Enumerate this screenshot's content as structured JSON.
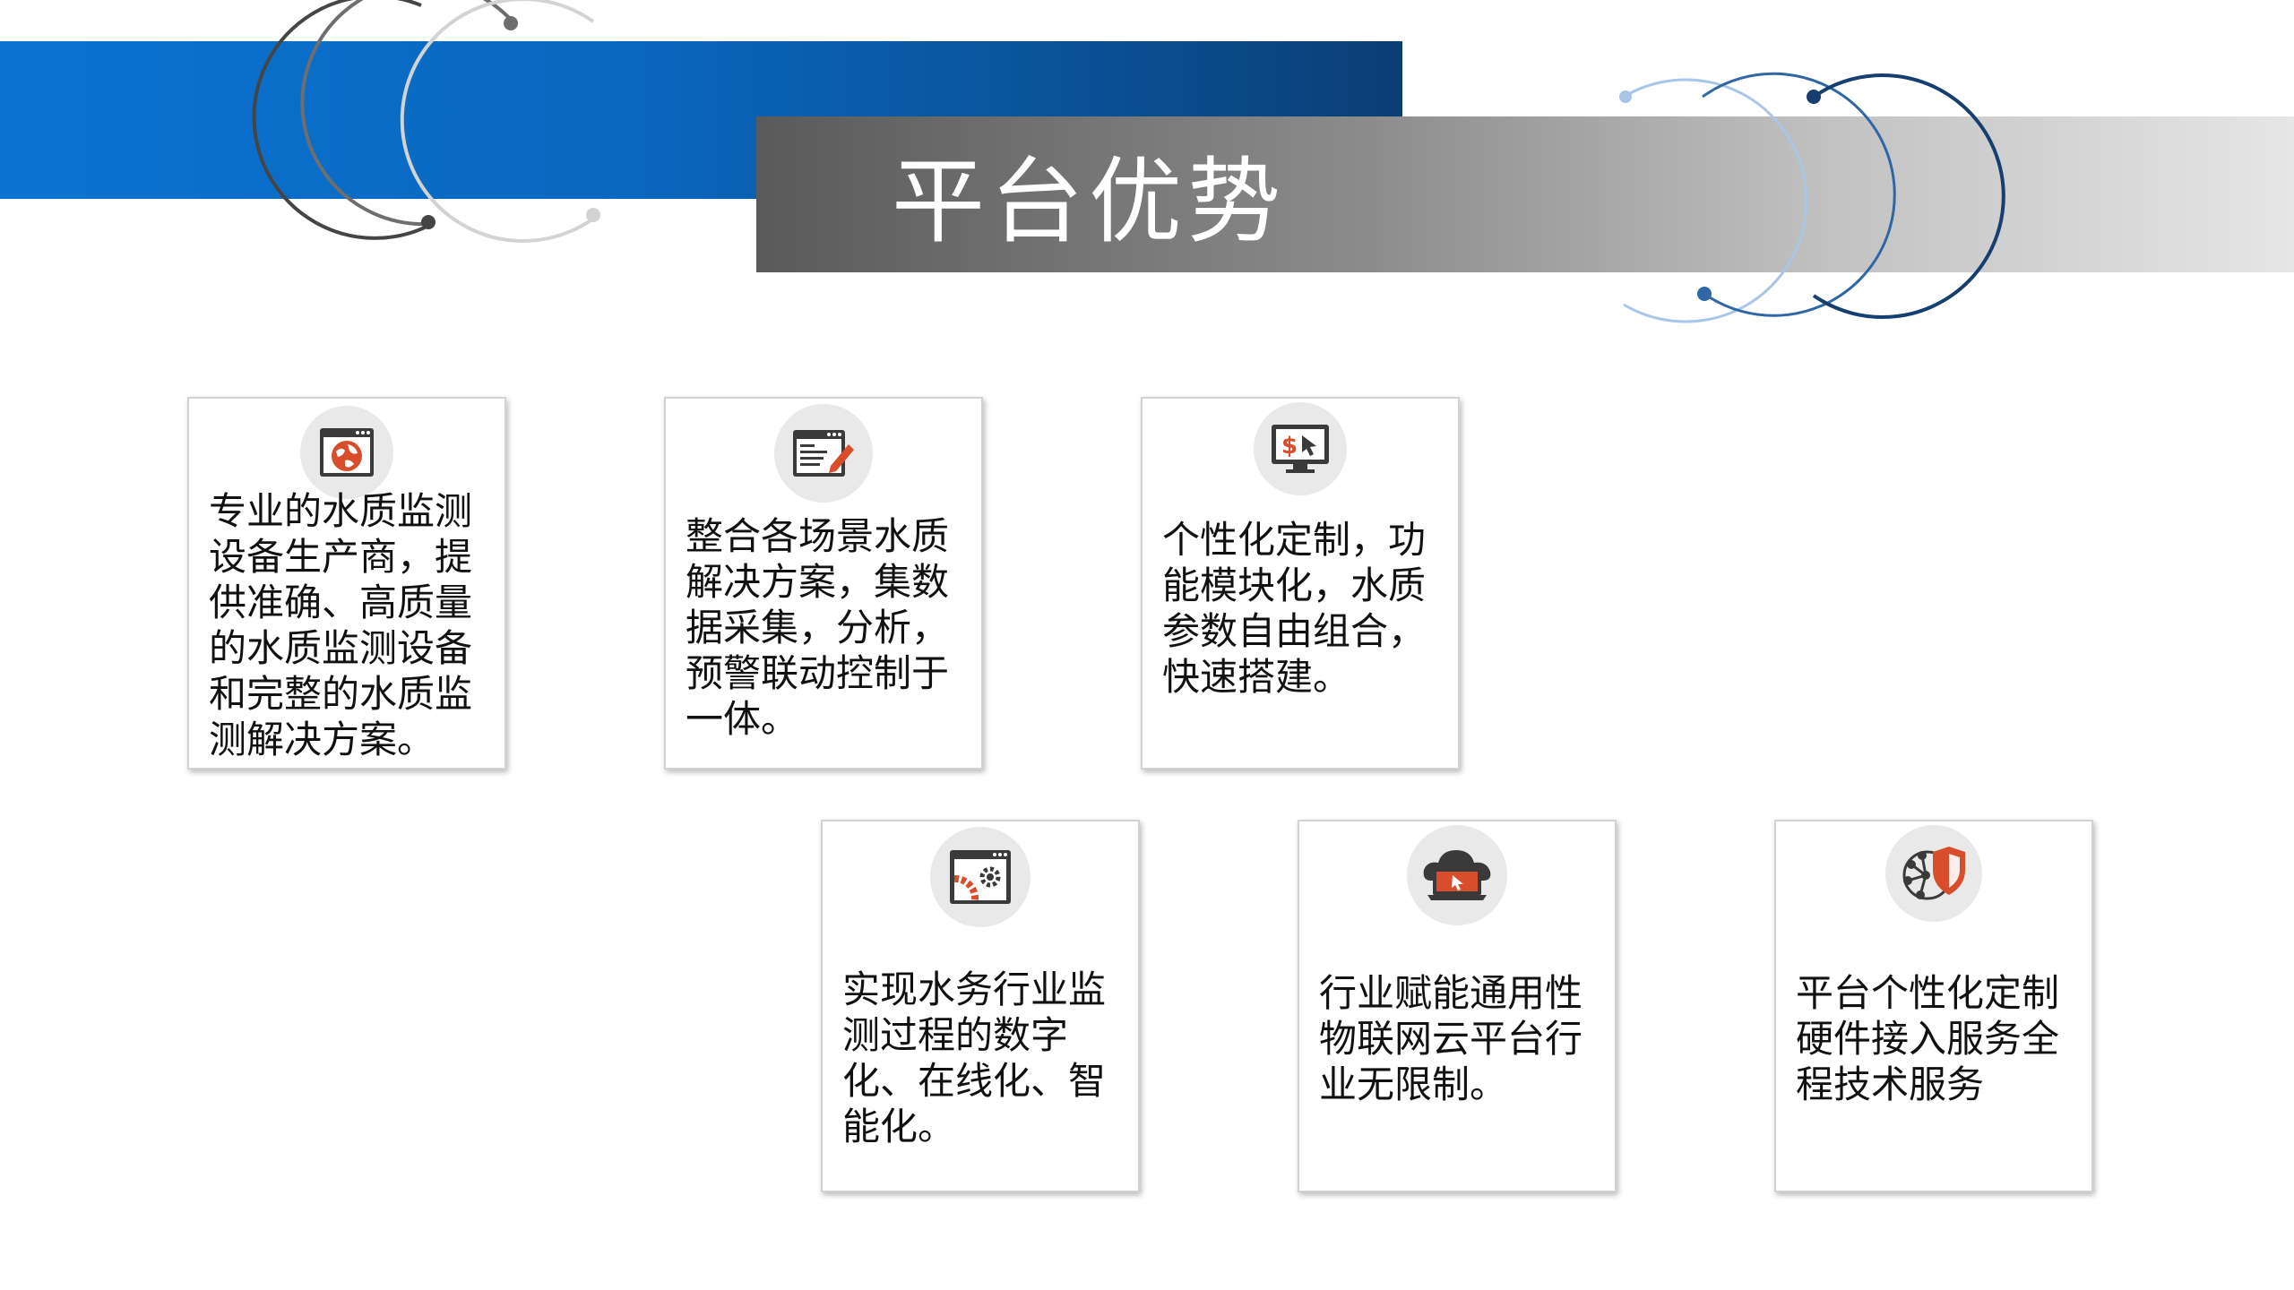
{
  "title": "平台优势",
  "cards": [
    {
      "text": "专业的水质监测设备生产商，提供准确、高质量的水质监测设备和完整的水质监测解决方案。",
      "icon": "globe-window-icon"
    },
    {
      "text": "整合各场景水质解决方案，集数据采集，分析，预警联动控制于一体。",
      "icon": "document-edit-icon"
    },
    {
      "text": "个性化定制，功能模块化，水质参数自由组合，快速搭建。",
      "icon": "monitor-dollar-icon"
    },
    {
      "text": "实现水务行业监测过程的数字化、在线化、智能化。",
      "icon": "window-gears-icon"
    },
    {
      "text": "行业赋能通用性物联网云平台行业无限制。",
      "icon": "cloud-laptop-icon"
    },
    {
      "text": "平台个性化定制硬件接入服务全程技术服务",
      "icon": "network-shield-icon"
    }
  ],
  "colors": {
    "accent_red": "#d84d2b",
    "icon_dark": "#3a3a3a",
    "blue": "#0a6ccc",
    "gray": "#8c8c8c"
  }
}
